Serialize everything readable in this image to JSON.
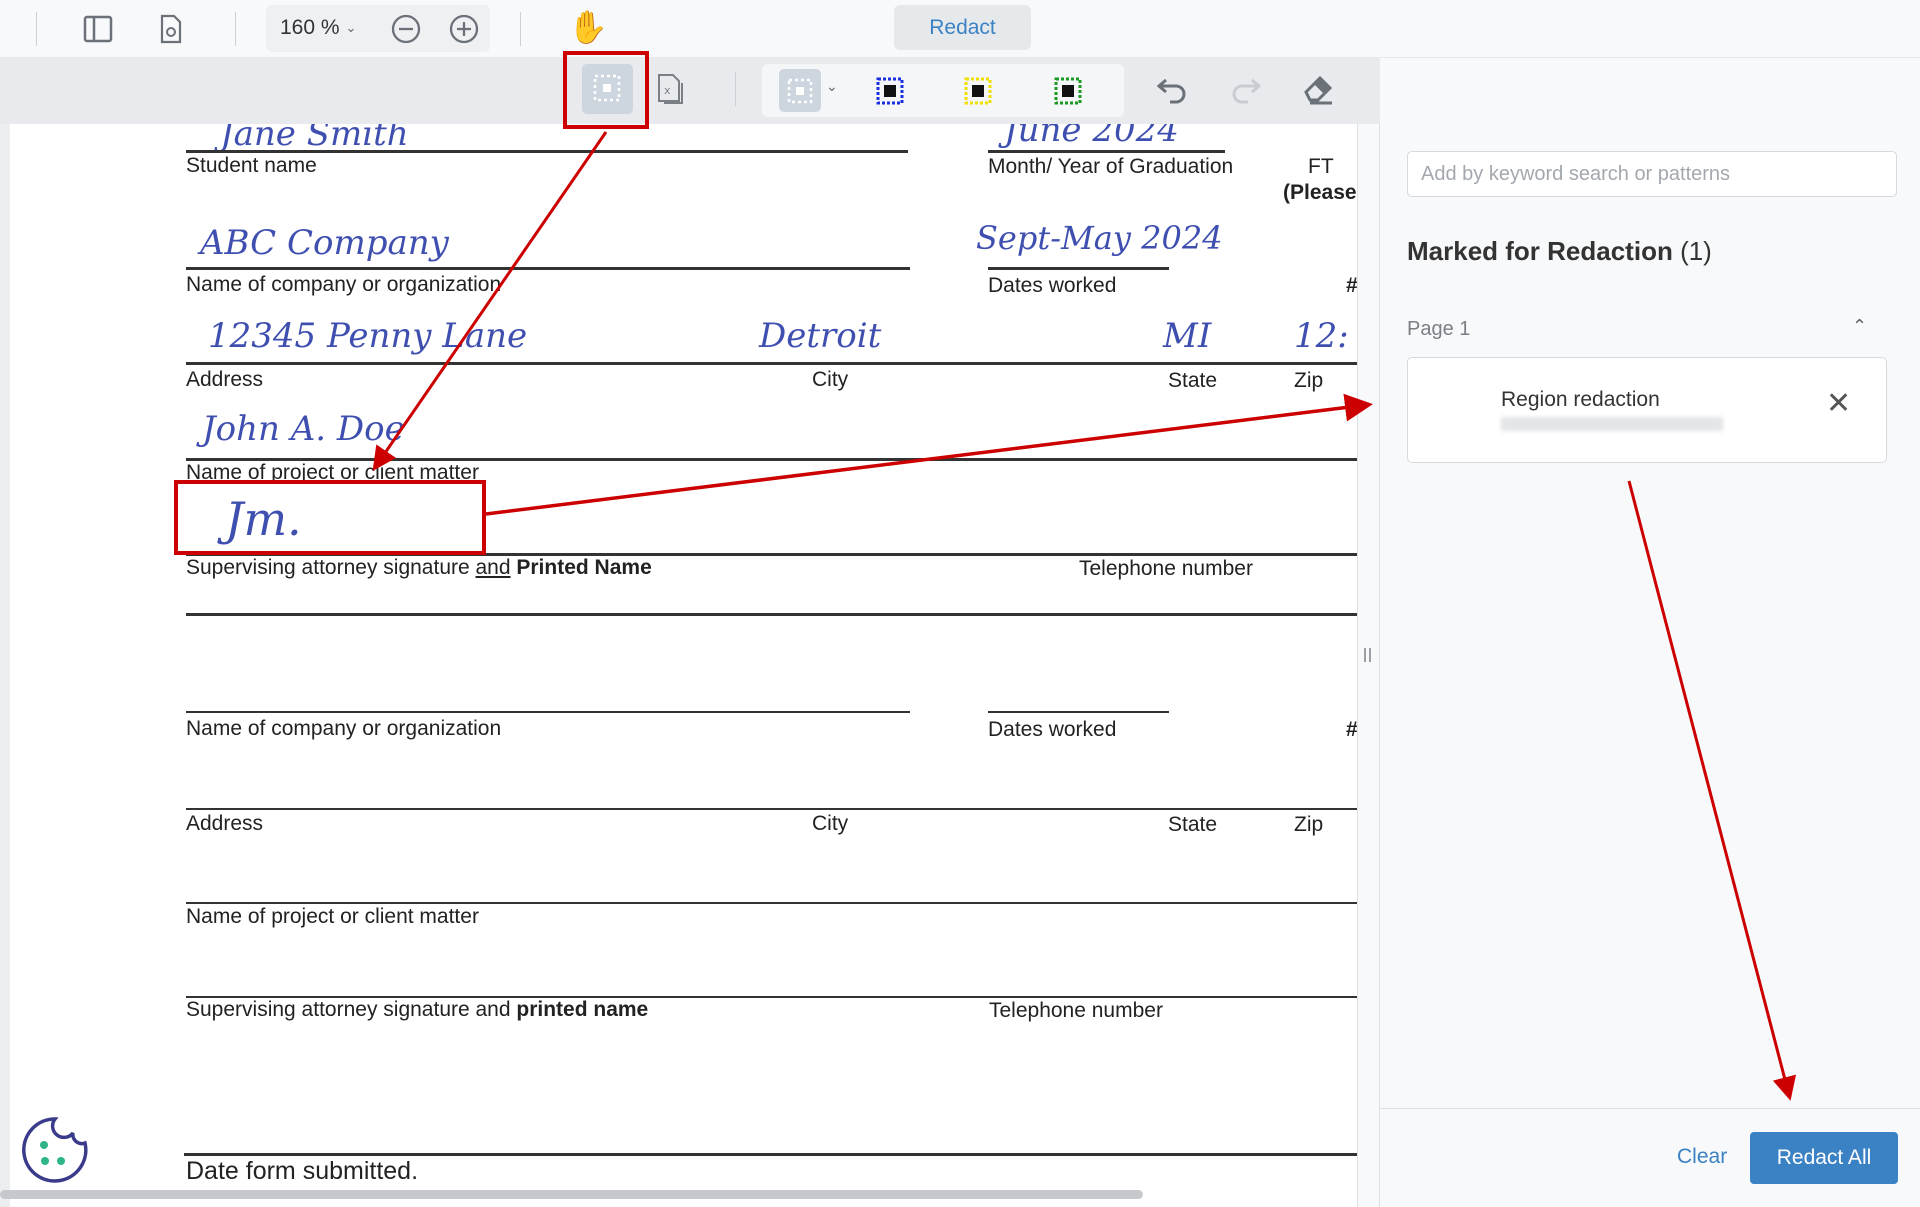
{
  "toolbar": {
    "zoom_level": "160 %",
    "redact_label": "Redact"
  },
  "document": {
    "handwriting": {
      "student_name": "Jane Smith",
      "graduation": "June 2024",
      "company": "ABC Company",
      "dates_worked": "Sept-May 2024",
      "address": "12345 Penny Lane",
      "city": "Detroit",
      "state": "MI",
      "zip": "12:",
      "project": "John A. Doe",
      "signature": "Jm."
    },
    "labels": {
      "student_name": "Student name",
      "graduation": "Month/ Year of Graduation",
      "ft": "FT",
      "please": "(Please",
      "company": "Name of company or organization",
      "dates_worked": "Dates worked",
      "hash": "#",
      "address": "Address",
      "city": "City",
      "state": "State",
      "zip": "Zip",
      "project": "Name of project or client matter",
      "supervising_a": "Supervising attorney signature ",
      "supervising_and": "and",
      "supervising_b": " Printed Name",
      "telephone": "Telephone number",
      "supervising2_a": "Supervising attorney signature and ",
      "supervising2_b": "printed name",
      "date_submitted": "Date form submitted."
    }
  },
  "panel": {
    "search_placeholder": "Add by keyword search or patterns",
    "heading": "Marked for Redaction",
    "count": "(1)",
    "page_label": "Page 1",
    "item_title": "Region redaction",
    "clear_label": "Clear",
    "redact_all_label": "Redact All"
  },
  "colors": {
    "accent": "#3b82c4",
    "annotation": "#cc0000"
  }
}
